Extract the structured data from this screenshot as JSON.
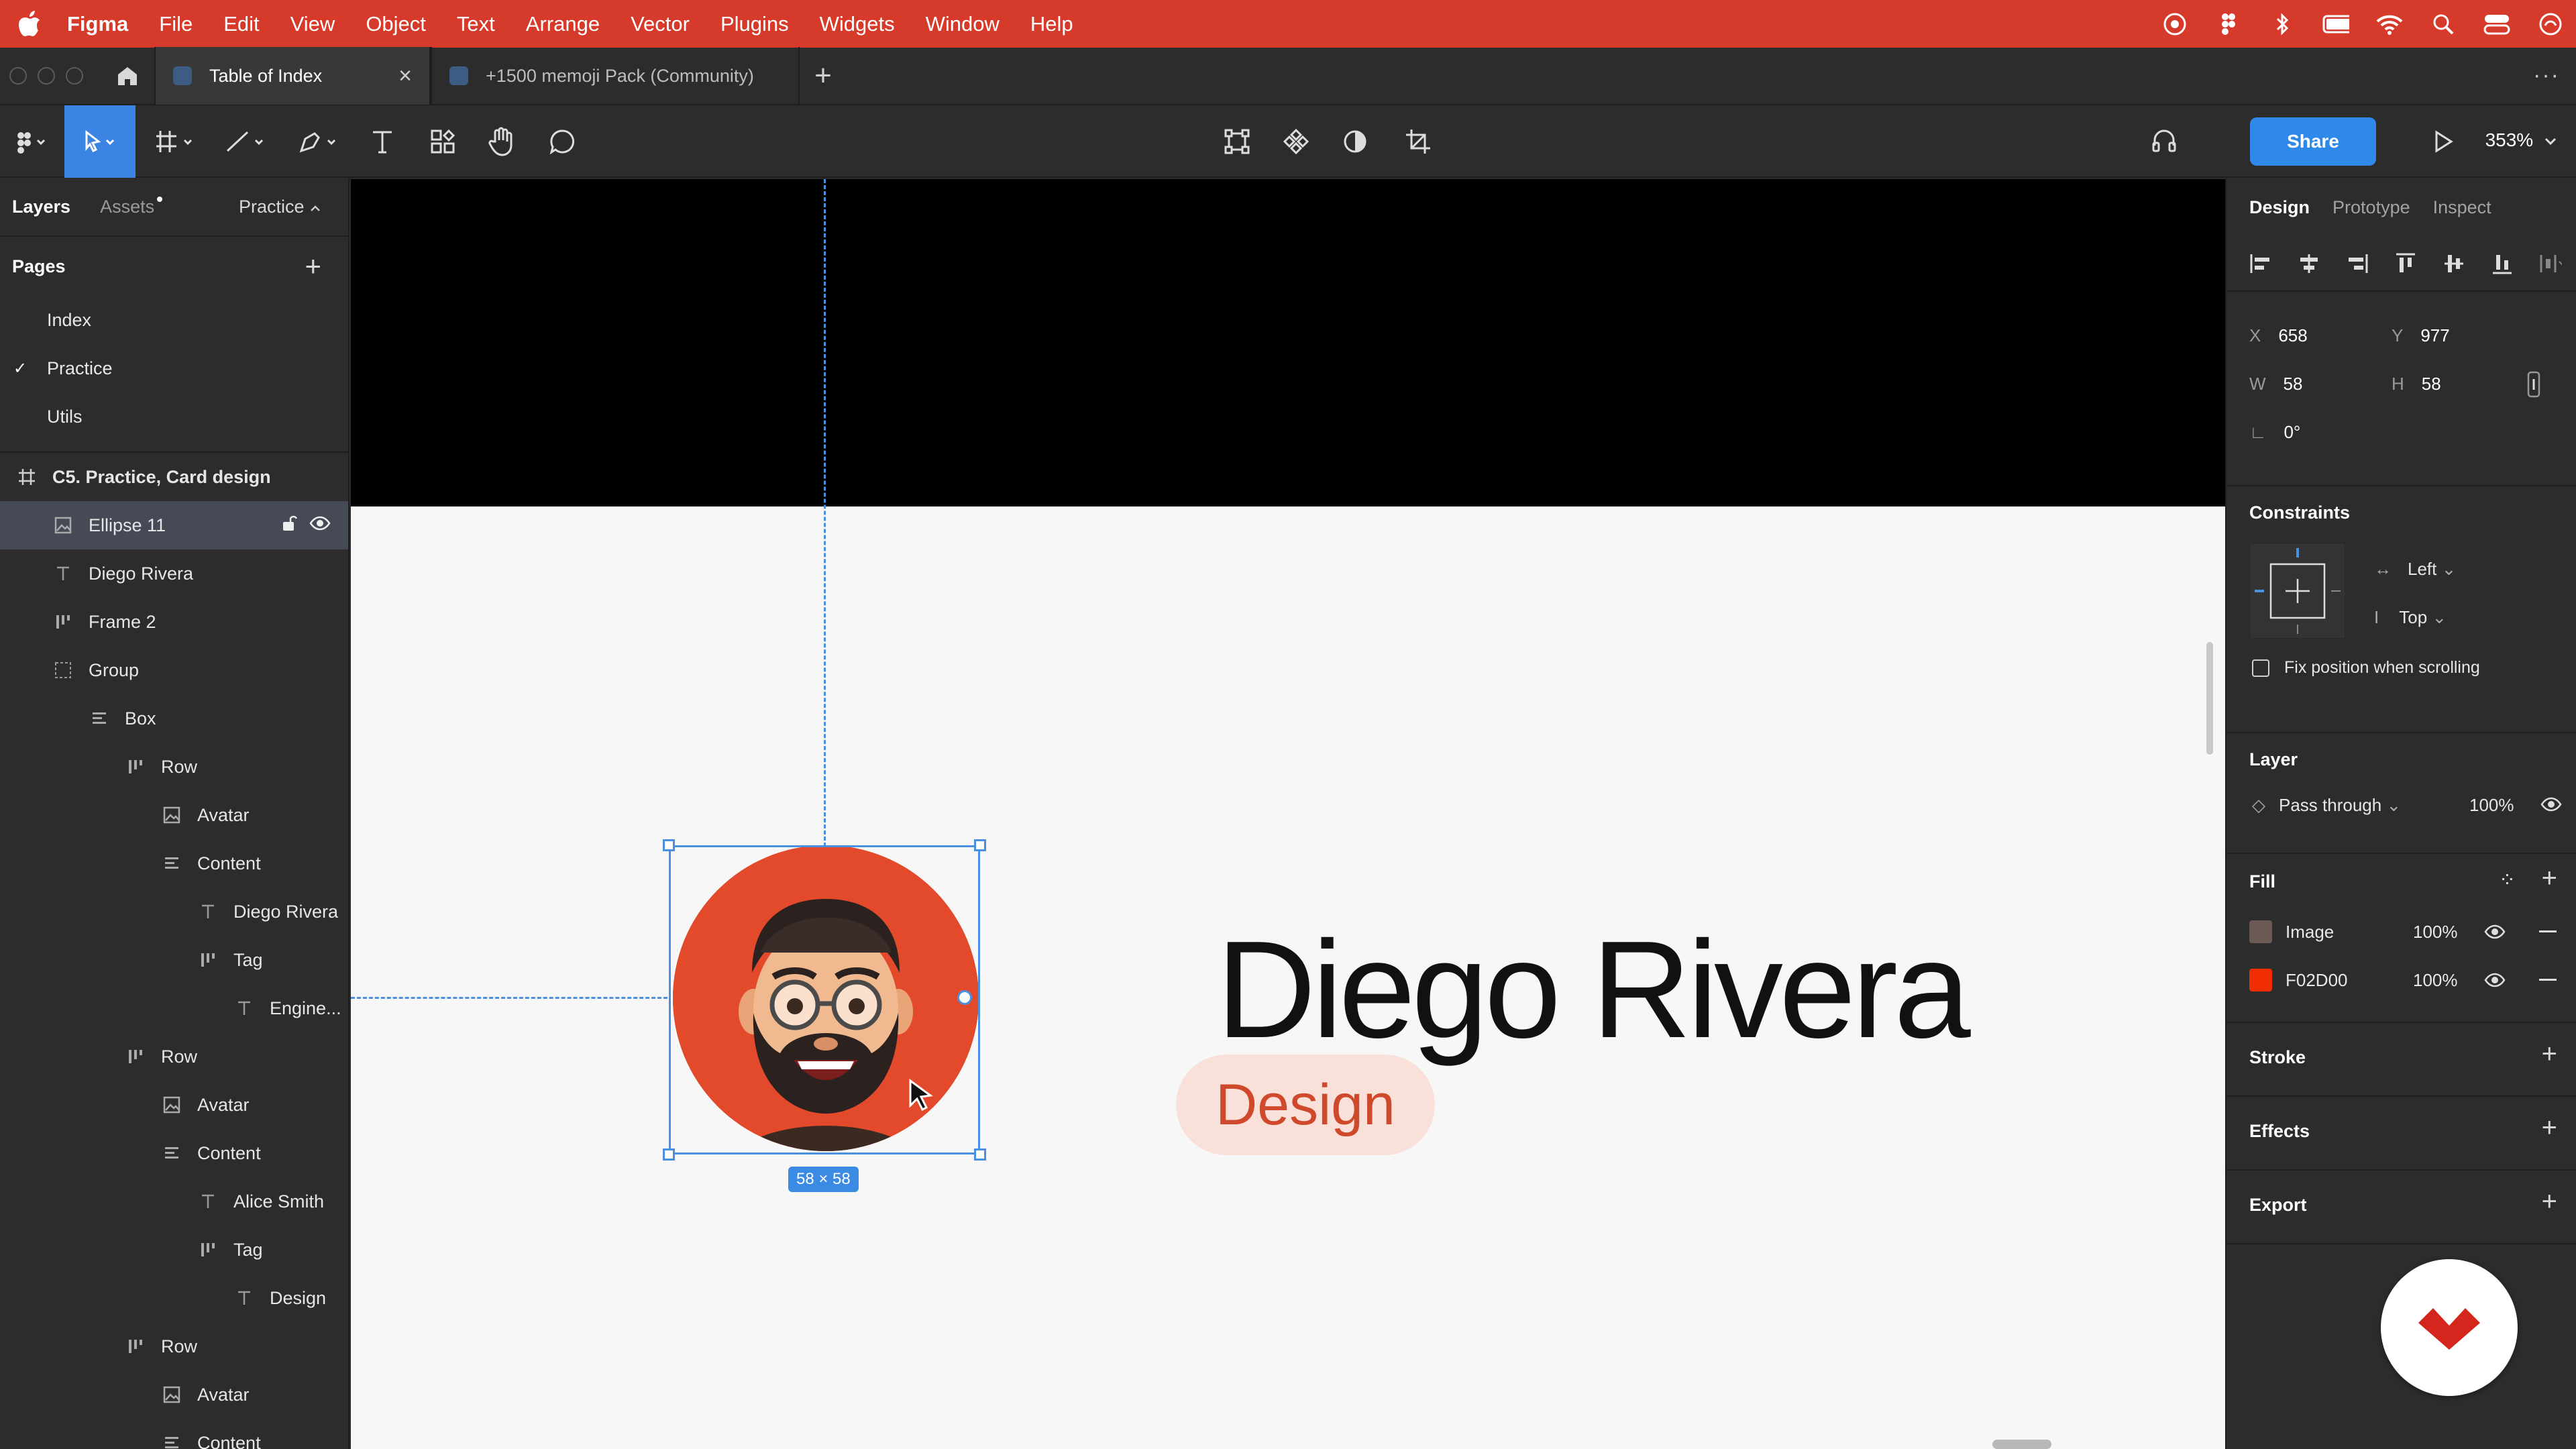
{
  "menubar": {
    "app_name": "Figma",
    "items": [
      "File",
      "Edit",
      "View",
      "Object",
      "Text",
      "Arrange",
      "Vector",
      "Plugins",
      "Widgets",
      "Window",
      "Help"
    ],
    "status_icons": [
      "creative-cloud-icon",
      "figma-icon",
      "bluetooth-icon",
      "battery-icon",
      "wifi-icon",
      "search-icon",
      "control-center-icon",
      "siri-icon"
    ]
  },
  "tabs": {
    "active": "Table of Index",
    "inactive": "+1500 memoji Pack (Community)"
  },
  "toolbar": {
    "share_label": "Share",
    "zoom": "353%"
  },
  "left_panel": {
    "tab_layers": "Layers",
    "tab_assets": "Assets",
    "current_page": "Practice",
    "pages_title": "Pages",
    "pages": [
      "Index",
      "Practice",
      "Utils"
    ],
    "selected_page": "Practice",
    "layers": [
      {
        "name": "C5. Practice, Card design",
        "icon": "frame-icon",
        "indent": 0
      },
      {
        "name": "Ellipse 11",
        "icon": "image-icon",
        "indent": 1
      },
      {
        "name": "Diego Rivera",
        "icon": "text-icon",
        "indent": 1
      },
      {
        "name": "Frame 2",
        "icon": "auto-layout-icon",
        "indent": 1
      },
      {
        "name": "Group",
        "icon": "group-icon",
        "indent": 1
      },
      {
        "name": "Box",
        "icon": "vertical-auto-layout-icon",
        "indent": 2
      },
      {
        "name": "Row",
        "icon": "auto-layout-icon",
        "indent": 3
      },
      {
        "name": "Avatar",
        "icon": "image-icon",
        "indent": 4
      },
      {
        "name": "Content",
        "icon": "vertical-auto-layout-icon",
        "indent": 4
      },
      {
        "name": "Diego Rivera",
        "icon": "text-icon",
        "indent": 5
      },
      {
        "name": "Tag",
        "icon": "auto-layout-icon",
        "indent": 5
      },
      {
        "name": "Engine...",
        "icon": "text-icon",
        "indent": 6
      },
      {
        "name": "Row",
        "icon": "auto-layout-icon",
        "indent": 3
      },
      {
        "name": "Avatar",
        "icon": "image-icon",
        "indent": 4
      },
      {
        "name": "Content",
        "icon": "vertical-auto-layout-icon",
        "indent": 4
      },
      {
        "name": "Alice Smith",
        "icon": "text-icon",
        "indent": 5
      },
      {
        "name": "Tag",
        "icon": "auto-layout-icon",
        "indent": 5
      },
      {
        "name": "Design",
        "icon": "text-icon",
        "indent": 6
      },
      {
        "name": "Row",
        "icon": "auto-layout-icon",
        "indent": 3
      },
      {
        "name": "Avatar",
        "icon": "image-icon",
        "indent": 4
      },
      {
        "name": "Content",
        "icon": "vertical-auto-layout-icon",
        "indent": 4
      }
    ]
  },
  "canvas": {
    "name_text": "Diego Rivera",
    "tag_text": "Design",
    "size_label": "58 × 58",
    "avatar_color": "#E34A2B",
    "tag_color": "#CF4A2C",
    "tag_bg": "#F9E1DA"
  },
  "right_panel": {
    "tabs": [
      "Design",
      "Prototype",
      "Inspect"
    ],
    "x": "658",
    "y": "977",
    "w": "58",
    "h": "58",
    "rotation": "0°",
    "constraints_title": "Constraints",
    "constraint_h": "Left",
    "constraint_v": "Top",
    "fix_position": "Fix position when scrolling",
    "layer_title": "Layer",
    "blend_mode": "Pass through",
    "layer_opacity": "100%",
    "fill_title": "Fill",
    "fills": [
      {
        "label": "Image",
        "opacity": "100%"
      },
      {
        "label": "F02D00",
        "opacity": "100%",
        "color": "#F02D00"
      }
    ],
    "stroke_title": "Stroke",
    "effects_title": "Effects",
    "export_title": "Export"
  }
}
